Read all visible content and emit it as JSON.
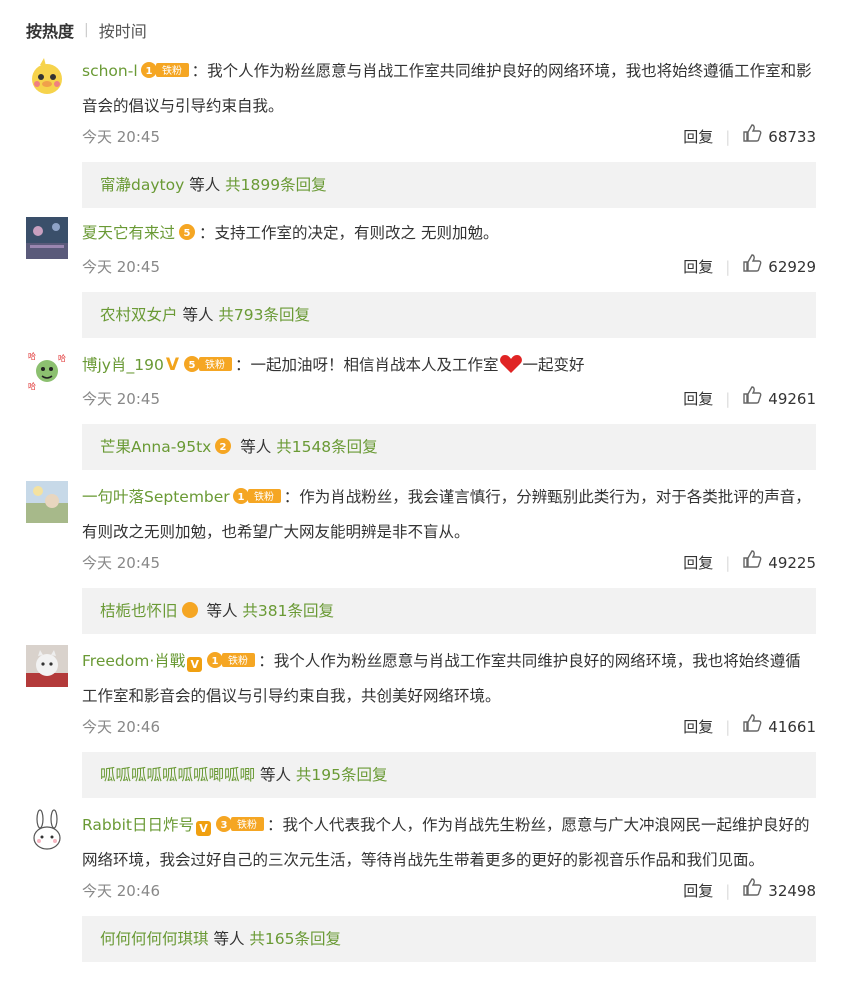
{
  "sort": {
    "active": "按热度",
    "inactive": "按时间"
  },
  "comments": [
    {
      "username": "schon-l",
      "level": "1",
      "fan_tag": "铁粉",
      "text": "：我个人作为粉丝愿意与肖战工作室共同维护良好的网络环境，我也将始终遵循工作室和影音会的倡议与引导约束自我。",
      "time": "今天 20:45",
      "reply_label": "回复",
      "likes": "68733",
      "reply_user": "甯瀞daytoy",
      "reply_etc": "等人",
      "reply_count": "共1899条回复"
    },
    {
      "username": "夏天它有来过",
      "level": "5",
      "text": "：支持工作室的决定，有则改之 无则加勉。",
      "time": "今天 20:45",
      "reply_label": "回复",
      "likes": "62929",
      "reply_user": "农村双女户",
      "reply_etc": "等人",
      "reply_count": "共793条回复"
    },
    {
      "username": "博jy肖_190",
      "level": "5",
      "fan_tag": "铁粉",
      "text": "：一起加油呀！相信肖战本人及工作室",
      "text_after": "一起变好",
      "time": "今天 20:45",
      "reply_label": "回复",
      "likes": "49261",
      "reply_user": "芒果Anna-95tx",
      "reply_etc": "等人",
      "reply_count": "共1548条回复"
    },
    {
      "username": "一句叶落September",
      "level": "1",
      "fan_tag": "铁粉",
      "text": "：作为肖战粉丝，我会谨言慎行，分辨甄别此类行为，对于各类批评的声音，有则改之无则加勉，也希望广大网友能明辨是非不盲从。",
      "time": "今天 20:45",
      "reply_label": "回复",
      "likes": "49225",
      "reply_user": "桔栀也怀旧",
      "reply_etc": "等人",
      "reply_count": "共381条回复"
    },
    {
      "username": "Freedom·肖戰",
      "level": "1",
      "fan_tag": "铁粉",
      "text": "：我个人作为粉丝愿意与肖战工作室共同维护良好的网络环境，我也将始终遵循工作室和影音会的倡议与引导约束自我，共创美好网络环境。",
      "time": "今天 20:46",
      "reply_label": "回复",
      "likes": "41661",
      "reply_user": "呱呱呱呱呱呱呱唧呱唧",
      "reply_etc": "等人",
      "reply_count": "共195条回复"
    },
    {
      "username": "Rabbit日日炸号",
      "level": "3",
      "fan_tag": "铁粉",
      "text": "：我个人代表我个人，作为肖战先生粉丝，愿意与广大冲浪网民一起维护良好的网络环境，我会过好自己的三次元生活，等待肖战先生带着更多的更好的影视音乐作品和我们见面。",
      "time": "今天 20:46",
      "reply_label": "回复",
      "likes": "32498",
      "reply_user": "何何何何何琪琪",
      "reply_etc": "等人",
      "reply_count": "共165条回复"
    }
  ]
}
